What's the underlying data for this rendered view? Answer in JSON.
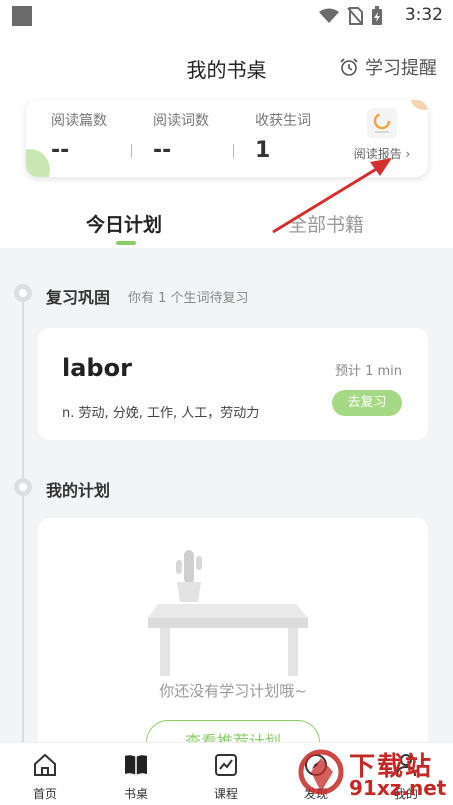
{
  "status_bar": {
    "time": "3:32"
  },
  "header": {
    "title": "我的书桌",
    "reminder_label": "学习提醒"
  },
  "stats": {
    "items": [
      {
        "label": "阅读篇数",
        "value": "--"
      },
      {
        "label": "阅读词数",
        "value": "--"
      },
      {
        "label": "收获生词",
        "value": "1"
      }
    ],
    "report_label": "阅读报告 ›"
  },
  "tabs": {
    "active": "今日计划",
    "inactive": "全部书籍"
  },
  "review": {
    "title": "复习巩固",
    "subtitle": "你有 1 个生词待复习",
    "word": "labor",
    "meaning": "n. 劳动, 分娩, 工作, 人工，劳动力",
    "estimate": "预计 1 min",
    "button_label": "去复习"
  },
  "plan": {
    "title": "我的计划",
    "empty_text": "你还没有学习计划哦~",
    "button_label": "查看推荐计划"
  },
  "bottom_nav": {
    "items": [
      {
        "label": "首页",
        "icon": "home-icon"
      },
      {
        "label": "书桌",
        "icon": "book-icon"
      },
      {
        "label": "课程",
        "icon": "chart-icon"
      },
      {
        "label": "发现",
        "icon": "compass-icon"
      },
      {
        "label": "我的",
        "icon": "user-icon"
      }
    ]
  },
  "watermark": {
    "name": "下载站",
    "url": "91xz.net"
  },
  "colors": {
    "accent": "#8dcc6a",
    "button_fill": "#a6d985",
    "arrow": "#d32f2f"
  }
}
